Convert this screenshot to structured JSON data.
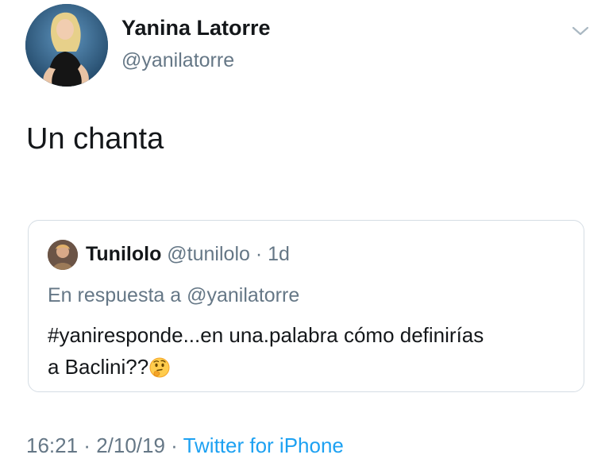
{
  "author": {
    "name": "Yanina Latorre",
    "handle": "@yanilatorre"
  },
  "tweet": {
    "text": "Un chanta"
  },
  "quoted_tweet": {
    "name": "Tunilolo",
    "handle": "@tunilolo",
    "separator": " · ",
    "age": "1d",
    "reply_prefix": "En respuesta a ",
    "reply_to": "@yanilatorre",
    "text_line1": "#yaniresponde...en una.palabra cómo definirías",
    "text_line2": "a Baclini??"
  },
  "footer": {
    "time": "16:21",
    "separator1": " · ",
    "date": "2/10/19",
    "separator2": " · ",
    "source": "Twitter for iPhone"
  },
  "icons": {
    "caret": "chevron-down-icon",
    "emoji": "thinking-face-icon"
  },
  "colors": {
    "text": "#14171a",
    "secondary": "#657786",
    "link": "#1da1f2",
    "border": "#d5dde4"
  }
}
